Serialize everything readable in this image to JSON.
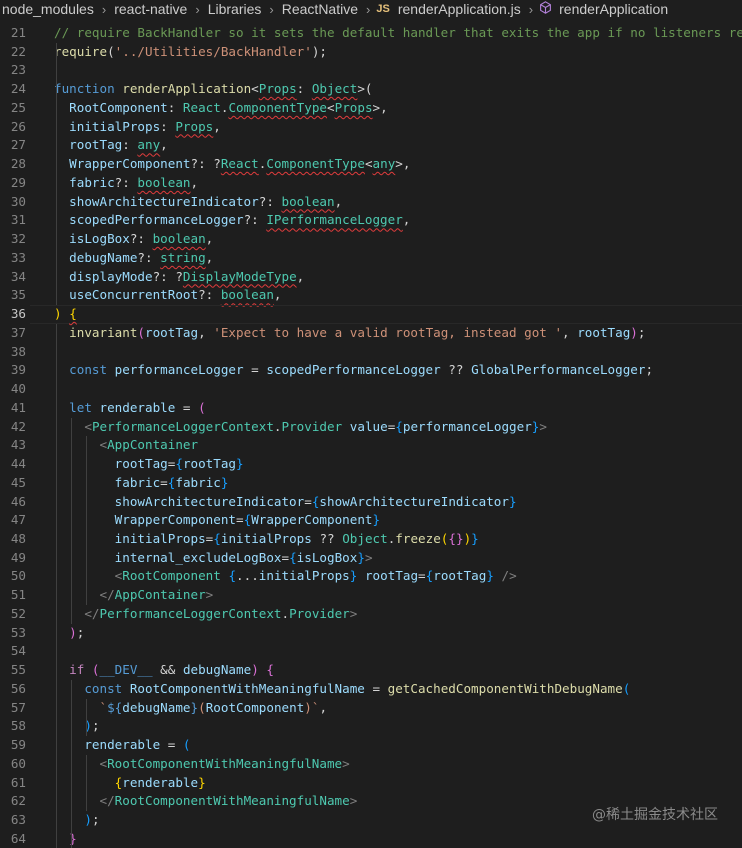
{
  "breadcrumb": {
    "items": [
      "node_modules",
      "react-native",
      "Libraries",
      "ReactNative"
    ],
    "file_badge": "JS",
    "file": "renderApplication.js",
    "symbol": "renderApplication"
  },
  "watermark": "@稀土掘金技术社区",
  "editor": {
    "active_line": 36,
    "lines": [
      {
        "n": "21",
        "t": [
          [
            "cm",
            "// require BackHandler so it sets the default handler that exits the app if no listeners respond"
          ]
        ]
      },
      {
        "n": "22",
        "t": [
          [
            "fn",
            "require"
          ],
          [
            "pu",
            "("
          ],
          [
            "st",
            "'../Utilities/BackHandler'"
          ],
          [
            "pu",
            ");"
          ]
        ]
      },
      {
        "n": "23",
        "t": []
      },
      {
        "n": "24",
        "t": [
          [
            "kw",
            "function "
          ],
          [
            "fn",
            "renderApplication"
          ],
          [
            "pu",
            "<"
          ],
          [
            "ty",
            "Props"
          ],
          [
            "pu",
            ": "
          ],
          [
            "ty",
            "Object"
          ],
          [
            "pu",
            ">("
          ]
        ]
      },
      {
        "n": "25",
        "t": [
          [
            "pu",
            "  "
          ],
          [
            "pr",
            "RootComponent"
          ],
          [
            "pu",
            ": "
          ],
          [
            "ty",
            "React"
          ],
          [
            "pu",
            "."
          ],
          [
            "ty",
            "ComponentType"
          ],
          [
            "pu",
            "<"
          ],
          [
            "ty",
            "Props"
          ],
          [
            "pu",
            ">,"
          ]
        ]
      },
      {
        "n": "26",
        "t": [
          [
            "pu",
            "  "
          ],
          [
            "pr",
            "initialProps"
          ],
          [
            "pu",
            ": "
          ],
          [
            "ty",
            "Props"
          ],
          [
            "pu",
            ","
          ]
        ]
      },
      {
        "n": "27",
        "t": [
          [
            "pu",
            "  "
          ],
          [
            "pr",
            "rootTag"
          ],
          [
            "pu",
            ": "
          ],
          [
            "ty",
            "any"
          ],
          [
            "pu",
            ","
          ]
        ]
      },
      {
        "n": "28",
        "t": [
          [
            "pu",
            "  "
          ],
          [
            "pr",
            "WrapperComponent"
          ],
          [
            "pu",
            "?: ?"
          ],
          [
            "ty",
            "React"
          ],
          [
            "pu",
            "."
          ],
          [
            "ty",
            "ComponentType"
          ],
          [
            "pu",
            "<"
          ],
          [
            "ty",
            "any"
          ],
          [
            "pu",
            ">,"
          ]
        ]
      },
      {
        "n": "29",
        "t": [
          [
            "pu",
            "  "
          ],
          [
            "pr",
            "fabric"
          ],
          [
            "pu",
            "?: "
          ],
          [
            "ty",
            "boolean"
          ],
          [
            "pu",
            ","
          ]
        ]
      },
      {
        "n": "30",
        "t": [
          [
            "pu",
            "  "
          ],
          [
            "pr",
            "showArchitectureIndicator"
          ],
          [
            "pu",
            "?: "
          ],
          [
            "ty",
            "boolean"
          ],
          [
            "pu",
            ","
          ]
        ]
      },
      {
        "n": "31",
        "t": [
          [
            "pu",
            "  "
          ],
          [
            "pr",
            "scopedPerformanceLogger"
          ],
          [
            "pu",
            "?: "
          ],
          [
            "ty",
            "IPerformanceLogger"
          ],
          [
            "pu",
            ","
          ]
        ]
      },
      {
        "n": "32",
        "t": [
          [
            "pu",
            "  "
          ],
          [
            "pr",
            "isLogBox"
          ],
          [
            "pu",
            "?: "
          ],
          [
            "ty",
            "boolean"
          ],
          [
            "pu",
            ","
          ]
        ]
      },
      {
        "n": "33",
        "t": [
          [
            "pu",
            "  "
          ],
          [
            "pr",
            "debugName"
          ],
          [
            "pu",
            "?: "
          ],
          [
            "ty",
            "string"
          ],
          [
            "pu",
            ","
          ]
        ]
      },
      {
        "n": "34",
        "t": [
          [
            "pu",
            "  "
          ],
          [
            "pr",
            "displayMode"
          ],
          [
            "pu",
            "?: ?"
          ],
          [
            "ty",
            "DisplayModeType"
          ],
          [
            "pu",
            ","
          ]
        ]
      },
      {
        "n": "35",
        "t": [
          [
            "pu",
            "  "
          ],
          [
            "pr",
            "useConcurrentRoot"
          ],
          [
            "pu",
            "?: "
          ],
          [
            "ty",
            "boolean"
          ],
          [
            "pu",
            ","
          ]
        ]
      },
      {
        "n": "36",
        "t": [
          [
            "br1",
            ")"
          ],
          [
            "pu",
            " "
          ],
          [
            "br1",
            "{"
          ]
        ]
      },
      {
        "n": "37",
        "t": [
          [
            "pu",
            "  "
          ],
          [
            "fn",
            "invariant"
          ],
          [
            "br2",
            "("
          ],
          [
            "pr",
            "rootTag"
          ],
          [
            "pu",
            ", "
          ],
          [
            "st",
            "'Expect to have a valid rootTag, instead got '"
          ],
          [
            "pu",
            ", "
          ],
          [
            "pr",
            "rootTag"
          ],
          [
            "br2",
            ")"
          ],
          [
            "pu",
            ";"
          ]
        ]
      },
      {
        "n": "38",
        "t": []
      },
      {
        "n": "39",
        "t": [
          [
            "pu",
            "  "
          ],
          [
            "kw",
            "const "
          ],
          [
            "pr",
            "performanceLogger"
          ],
          [
            "pu",
            " = "
          ],
          [
            "pr",
            "scopedPerformanceLogger"
          ],
          [
            "pu",
            " ?? "
          ],
          [
            "pr",
            "GlobalPerformanceLogger"
          ],
          [
            "pu",
            ";"
          ]
        ]
      },
      {
        "n": "40",
        "t": []
      },
      {
        "n": "41",
        "t": [
          [
            "pu",
            "  "
          ],
          [
            "kw",
            "let "
          ],
          [
            "pr",
            "renderable"
          ],
          [
            "pu",
            " = "
          ],
          [
            "br2",
            "("
          ]
        ]
      },
      {
        "n": "42",
        "t": [
          [
            "pu",
            "    "
          ],
          [
            "tg",
            "<"
          ],
          [
            "ty",
            "PerformanceLoggerContext"
          ],
          [
            "pu",
            "."
          ],
          [
            "ty",
            "Provider"
          ],
          [
            "pu",
            " "
          ],
          [
            "at",
            "value"
          ],
          [
            "pu",
            "="
          ],
          [
            "br3",
            "{"
          ],
          [
            "pr",
            "performanceLogger"
          ],
          [
            "br3",
            "}"
          ],
          [
            "tg",
            ">"
          ]
        ]
      },
      {
        "n": "43",
        "t": [
          [
            "pu",
            "      "
          ],
          [
            "tg",
            "<"
          ],
          [
            "ty",
            "AppContainer"
          ]
        ]
      },
      {
        "n": "44",
        "t": [
          [
            "pu",
            "        "
          ],
          [
            "at",
            "rootTag"
          ],
          [
            "pu",
            "="
          ],
          [
            "br3",
            "{"
          ],
          [
            "pr",
            "rootTag"
          ],
          [
            "br3",
            "}"
          ]
        ]
      },
      {
        "n": "45",
        "t": [
          [
            "pu",
            "        "
          ],
          [
            "at",
            "fabric"
          ],
          [
            "pu",
            "="
          ],
          [
            "br3",
            "{"
          ],
          [
            "pr",
            "fabric"
          ],
          [
            "br3",
            "}"
          ]
        ]
      },
      {
        "n": "46",
        "t": [
          [
            "pu",
            "        "
          ],
          [
            "at",
            "showArchitectureIndicator"
          ],
          [
            "pu",
            "="
          ],
          [
            "br3",
            "{"
          ],
          [
            "pr",
            "showArchitectureIndicator"
          ],
          [
            "br3",
            "}"
          ]
        ]
      },
      {
        "n": "47",
        "t": [
          [
            "pu",
            "        "
          ],
          [
            "at",
            "WrapperComponent"
          ],
          [
            "pu",
            "="
          ],
          [
            "br3",
            "{"
          ],
          [
            "pr",
            "WrapperComponent"
          ],
          [
            "br3",
            "}"
          ]
        ]
      },
      {
        "n": "48",
        "t": [
          [
            "pu",
            "        "
          ],
          [
            "at",
            "initialProps"
          ],
          [
            "pu",
            "="
          ],
          [
            "br3",
            "{"
          ],
          [
            "pr",
            "initialProps"
          ],
          [
            "pu",
            " ?? "
          ],
          [
            "ty",
            "Object"
          ],
          [
            "pu",
            "."
          ],
          [
            "fn",
            "freeze"
          ],
          [
            "br1",
            "("
          ],
          [
            "br2",
            "{}"
          ],
          [
            "br1",
            ")"
          ],
          [
            "br3",
            "}"
          ]
        ]
      },
      {
        "n": "49",
        "t": [
          [
            "pu",
            "        "
          ],
          [
            "at",
            "internal_excludeLogBox"
          ],
          [
            "pu",
            "="
          ],
          [
            "br3",
            "{"
          ],
          [
            "pr",
            "isLogBox"
          ],
          [
            "br3",
            "}"
          ],
          [
            "tg",
            ">"
          ]
        ]
      },
      {
        "n": "50",
        "t": [
          [
            "pu",
            "        "
          ],
          [
            "tg",
            "<"
          ],
          [
            "ty",
            "RootComponent"
          ],
          [
            "pu",
            " "
          ],
          [
            "br3",
            "{"
          ],
          [
            "pu",
            "..."
          ],
          [
            "pr",
            "initialProps"
          ],
          [
            "br3",
            "}"
          ],
          [
            "pu",
            " "
          ],
          [
            "at",
            "rootTag"
          ],
          [
            "pu",
            "="
          ],
          [
            "br3",
            "{"
          ],
          [
            "pr",
            "rootTag"
          ],
          [
            "br3",
            "}"
          ],
          [
            "pu",
            " "
          ],
          [
            "tg",
            "/>"
          ]
        ]
      },
      {
        "n": "51",
        "t": [
          [
            "pu",
            "      "
          ],
          [
            "tg",
            "</"
          ],
          [
            "ty",
            "AppContainer"
          ],
          [
            "tg",
            ">"
          ]
        ]
      },
      {
        "n": "52",
        "t": [
          [
            "pu",
            "    "
          ],
          [
            "tg",
            "</"
          ],
          [
            "ty",
            "PerformanceLoggerContext"
          ],
          [
            "pu",
            "."
          ],
          [
            "ty",
            "Provider"
          ],
          [
            "tg",
            ">"
          ]
        ]
      },
      {
        "n": "53",
        "t": [
          [
            "pu",
            "  "
          ],
          [
            "br2",
            ")"
          ],
          [
            "pu",
            ";"
          ]
        ]
      },
      {
        "n": "54",
        "t": []
      },
      {
        "n": "55",
        "t": [
          [
            "pu",
            "  "
          ],
          [
            "ctl",
            "if "
          ],
          [
            "br2",
            "("
          ],
          [
            "kw",
            "__DEV__"
          ],
          [
            "pu",
            " && "
          ],
          [
            "pr",
            "debugName"
          ],
          [
            "br2",
            ")"
          ],
          [
            "pu",
            " "
          ],
          [
            "br2",
            "{"
          ]
        ]
      },
      {
        "n": "56",
        "t": [
          [
            "pu",
            "    "
          ],
          [
            "kw",
            "const "
          ],
          [
            "pr",
            "RootComponentWithMeaningfulName"
          ],
          [
            "pu",
            " = "
          ],
          [
            "fn",
            "getCachedComponentWithDebugName"
          ],
          [
            "br3",
            "("
          ]
        ]
      },
      {
        "n": "57",
        "t": [
          [
            "pu",
            "      "
          ],
          [
            "st",
            "`"
          ],
          [
            "kw",
            "${"
          ],
          [
            "pr",
            "debugName"
          ],
          [
            "kw",
            "}"
          ],
          [
            "st",
            "("
          ],
          [
            "pr",
            "RootComponent"
          ],
          [
            "st",
            ")`"
          ],
          [
            "pu",
            ","
          ]
        ]
      },
      {
        "n": "58",
        "t": [
          [
            "pu",
            "    "
          ],
          [
            "br3",
            ")"
          ],
          [
            "pu",
            ";"
          ]
        ]
      },
      {
        "n": "59",
        "t": [
          [
            "pu",
            "    "
          ],
          [
            "pr",
            "renderable"
          ],
          [
            "pu",
            " = "
          ],
          [
            "br3",
            "("
          ]
        ]
      },
      {
        "n": "60",
        "t": [
          [
            "pu",
            "      "
          ],
          [
            "tg",
            "<"
          ],
          [
            "ty",
            "RootComponentWithMeaningfulName"
          ],
          [
            "tg",
            ">"
          ]
        ]
      },
      {
        "n": "61",
        "t": [
          [
            "pu",
            "        "
          ],
          [
            "br1",
            "{"
          ],
          [
            "pr",
            "renderable"
          ],
          [
            "br1",
            "}"
          ]
        ]
      },
      {
        "n": "62",
        "t": [
          [
            "pu",
            "      "
          ],
          [
            "tg",
            "</"
          ],
          [
            "ty",
            "RootComponentWithMeaningfulName"
          ],
          [
            "tg",
            ">"
          ]
        ]
      },
      {
        "n": "63",
        "t": [
          [
            "pu",
            "    "
          ],
          [
            "br3",
            ")"
          ],
          [
            "pu",
            ";"
          ]
        ]
      },
      {
        "n": "64",
        "t": [
          [
            "pu",
            "  "
          ],
          [
            "br2",
            "}"
          ]
        ]
      }
    ],
    "squiggles": {
      "24": [
        "Props",
        "Object"
      ],
      "25": [
        "ComponentType",
        "Props"
      ],
      "26": [
        "Props"
      ],
      "27": [
        "any"
      ],
      "28": [
        "React",
        "ComponentType",
        "any"
      ],
      "29": [
        "boolean"
      ],
      "30": [
        "boolean"
      ],
      "31": [
        "IPerformanceLogger"
      ],
      "32": [
        "boolean"
      ],
      "33": [
        "string"
      ],
      "34": [
        "DisplayModeType"
      ],
      "35": [
        "boolean"
      ],
      "36": [
        "{"
      ]
    }
  }
}
